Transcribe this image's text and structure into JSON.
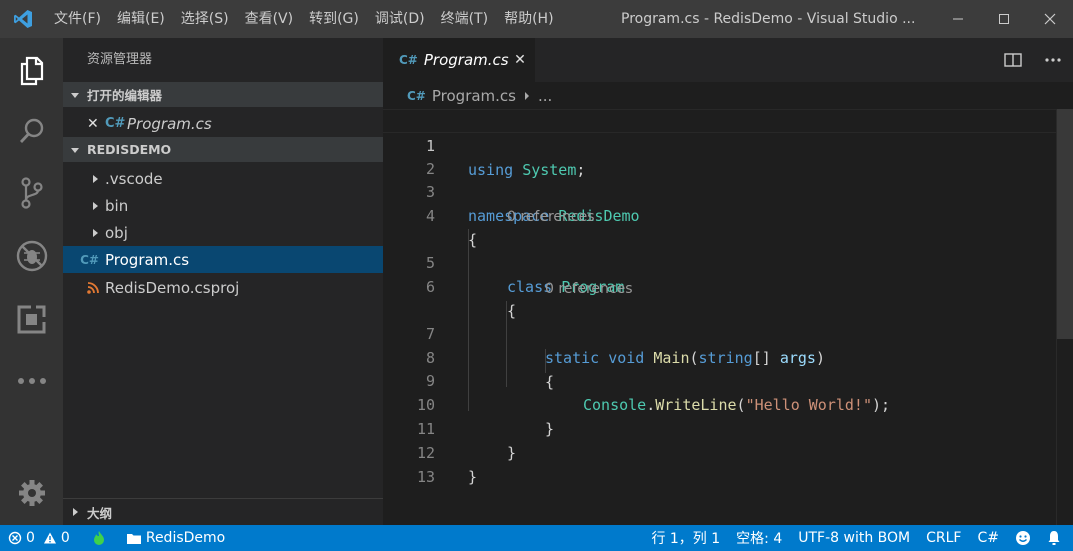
{
  "window": {
    "title": "Program.cs - RedisDemo - Visual Studio ...",
    "menu": [
      "文件(F)",
      "编辑(E)",
      "选择(S)",
      "查看(V)",
      "转到(G)",
      "调试(D)",
      "终端(T)",
      "帮助(H)"
    ]
  },
  "activity_bar": {
    "items": [
      "explorer-icon",
      "search-icon",
      "source-control-icon",
      "debug-icon",
      "extensions-icon",
      "more-icon"
    ],
    "bottom": "settings-gear-icon"
  },
  "sidebar": {
    "title": "资源管理器",
    "open_editors": {
      "label": "打开的编辑器",
      "items": [
        {
          "name": "Program.cs",
          "close": "✕"
        }
      ]
    },
    "project": {
      "label": "REDISDEMO",
      "tree": [
        {
          "name": ".vscode",
          "type": "folder"
        },
        {
          "name": "bin",
          "type": "folder"
        },
        {
          "name": "obj",
          "type": "folder"
        },
        {
          "name": "Program.cs",
          "type": "csharp",
          "selected": true
        },
        {
          "name": "RedisDemo.csproj",
          "type": "rss"
        }
      ]
    },
    "outline_label": "大纲"
  },
  "editor": {
    "tab": {
      "label": "Program.cs",
      "close": "✕"
    },
    "breadcrumb": {
      "file": "Program.cs",
      "more": "..."
    },
    "line_numbers": [
      "1",
      "2",
      "3",
      "4",
      "5",
      "6",
      "7",
      "8",
      "9",
      "10",
      "11",
      "12",
      "13"
    ],
    "lines": {
      "l1": [
        "using",
        " ",
        "System",
        ";"
      ],
      "l3": [
        "namespace",
        " ",
        "RedisDemo"
      ],
      "l4": [
        "{"
      ],
      "l5": [
        "class",
        " ",
        "Program"
      ],
      "l6": [
        "{"
      ],
      "l7": [
        "static",
        " ",
        "void",
        " ",
        "Main",
        "(",
        "string",
        "[]",
        " ",
        "args",
        ")"
      ],
      "l8": [
        "{"
      ],
      "l9": [
        "Console",
        ".",
        "WriteLine",
        "(",
        "\"Hello World!\"",
        ");"
      ],
      "l10": [
        "}"
      ],
      "l11": [
        "}"
      ],
      "l12": [
        "}"
      ]
    },
    "code_lens": [
      "0 references",
      "0 references"
    ]
  },
  "colors": {
    "keyword": "#569cd6",
    "type": "#4ec9b0",
    "function": "#dcdcaa",
    "variable": "#9cdcfe",
    "string": "#ce9178",
    "status_bar": "#007acc",
    "selection": "#094771"
  },
  "status_bar": {
    "errors": "0",
    "warnings": "0",
    "folder": "RedisDemo",
    "position": "行 1，列 1",
    "indent": "空格: 4",
    "encoding": "UTF-8 with BOM",
    "eol": "CRLF",
    "language": "C#"
  }
}
